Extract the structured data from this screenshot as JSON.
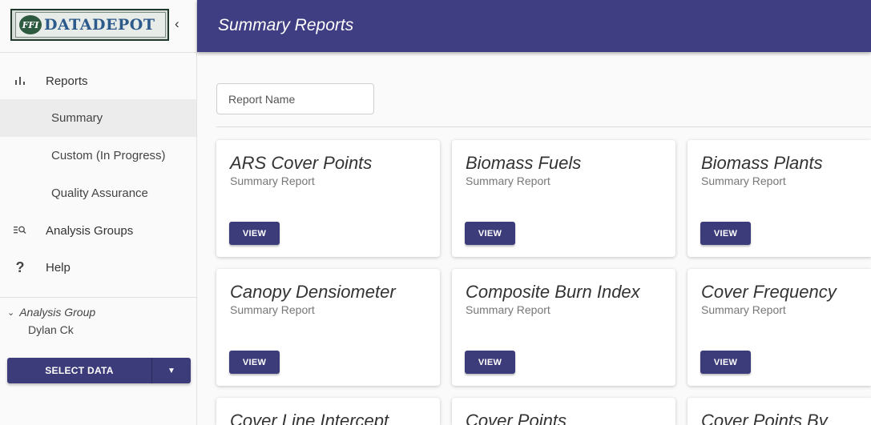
{
  "sidebar": {
    "logo_badge": "FFI",
    "logo_text": "DATADEPOT",
    "collapse_icon": "chevron-left-icon",
    "items": [
      {
        "label": "Reports",
        "icon": "bar-chart-icon"
      },
      {
        "label": "Summary"
      },
      {
        "label": "Custom (In Progress)"
      },
      {
        "label": "Quality Assurance"
      },
      {
        "label": "Analysis Groups",
        "icon": "list-search-icon"
      },
      {
        "label": "Help",
        "icon": "question-icon"
      }
    ],
    "group_label": "Analysis Group",
    "group_value": "Dylan Ck",
    "select_label": "SELECT DATA"
  },
  "header": {
    "title": "Summary Reports"
  },
  "search": {
    "placeholder": "Report Name"
  },
  "cards": [
    {
      "title": "ARS Cover Points",
      "subtitle": "Summary Report",
      "button": "VIEW"
    },
    {
      "title": "Biomass Fuels",
      "subtitle": "Summary Report",
      "button": "VIEW"
    },
    {
      "title": "Biomass Plants",
      "subtitle": "Summary Report",
      "button": "VIEW"
    },
    {
      "title": "Canopy Densiometer",
      "subtitle": "Summary Report",
      "button": "VIEW"
    },
    {
      "title": "Composite Burn Index",
      "subtitle": "Summary Report",
      "button": "VIEW"
    },
    {
      "title": "Cover Frequency",
      "subtitle": "Summary Report",
      "button": "VIEW"
    },
    {
      "title": "Cover Line Intercept",
      "subtitle": "",
      "button": ""
    },
    {
      "title": "Cover Points",
      "subtitle": "",
      "button": ""
    },
    {
      "title": "Cover Points By",
      "subtitle": "",
      "button": ""
    }
  ],
  "colors": {
    "primary": "#3f3e82",
    "button": "#3d3c7a",
    "active_nav": "#ececec"
  }
}
